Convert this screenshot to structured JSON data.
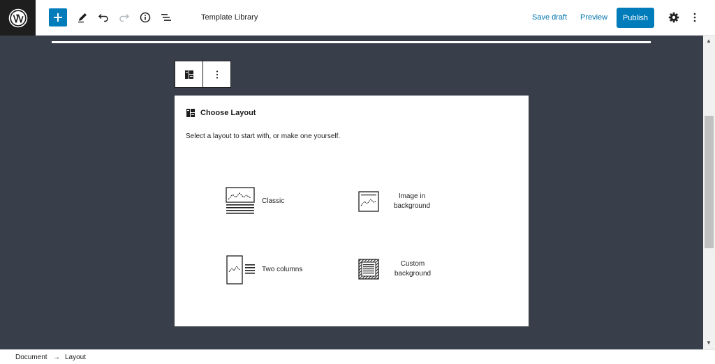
{
  "header": {
    "document_title": "Template Library",
    "save_draft_label": "Save draft",
    "preview_label": "Preview",
    "publish_label": "Publish"
  },
  "placeholder": {
    "title": "Choose Layout",
    "description": "Select a layout to start with, or make one yourself.",
    "layouts": [
      {
        "label": "Classic"
      },
      {
        "label": "Image in\nbackground"
      },
      {
        "label": "Two columns"
      },
      {
        "label": "Custom\nbackground"
      }
    ]
  },
  "breadcrumb": {
    "items": [
      "Document",
      "Layout"
    ],
    "separator": "→"
  },
  "colors": {
    "accent": "#007cba",
    "link": "#0073aa",
    "canvas": "#393f4a",
    "wp_logo_bg": "#1e1e1e"
  },
  "icons": {
    "logo": "wordpress-logo-icon",
    "add": "plus-icon",
    "tools": "pencil-icon",
    "undo": "undo-icon",
    "redo": "redo-icon",
    "info": "info-icon",
    "outline": "list-view-icon",
    "settings": "gear-icon",
    "more": "more-vertical-icon"
  }
}
